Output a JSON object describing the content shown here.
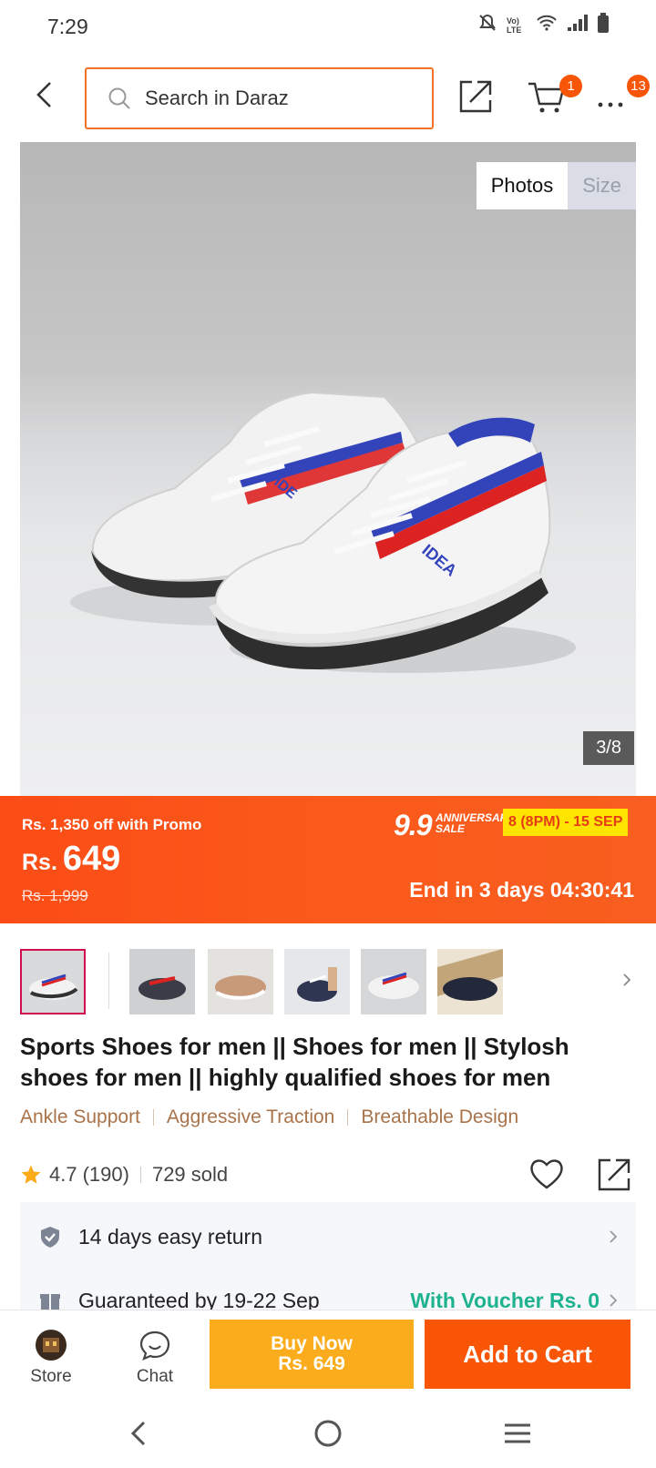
{
  "status": {
    "time": "7:29",
    "network": "Vo) LTE"
  },
  "header": {
    "search_placeholder": "Search in Daraz",
    "cart_count": "1",
    "more_count": "13"
  },
  "gallery": {
    "tabs": [
      "Photos",
      "Size"
    ],
    "counter": "3/8"
  },
  "promo": {
    "promo_text": "Rs. 1,350 off with Promo",
    "currency": "Rs.",
    "price": "649",
    "old_price": "Rs. 1,999",
    "sale_number": "9.9",
    "sale_word_1": "ANNIVERSARY",
    "sale_word_2": "SALE",
    "sale_dates": "8 (8PM) - 15 SEP",
    "countdown": "End in 3 days 04:30:41"
  },
  "product": {
    "title": "Sports Shoes for men || Shoes for men || Stylosh shoes for men || highly qualified shoes for men",
    "features": [
      "Ankle Support",
      "Aggressive Traction",
      "Breathable Design"
    ],
    "rating": "4.7",
    "reviews": "(190)",
    "sold": "729 sold"
  },
  "service": {
    "return_text": "14 days easy return",
    "delivery_text": "Guaranteed by 19-22 Sep",
    "voucher_text": "With Voucher Rs. 0"
  },
  "bottom": {
    "store_label": "Store",
    "chat_label": "Chat",
    "buy_now_line1": "Buy Now",
    "buy_now_line2": "Rs. 649",
    "add_to_cart": "Add to Cart"
  },
  "colors": {
    "accent": "#f85606",
    "buy_now": "#fbac1c",
    "feature_text": "#a8734a",
    "voucher": "#1fb28f"
  }
}
